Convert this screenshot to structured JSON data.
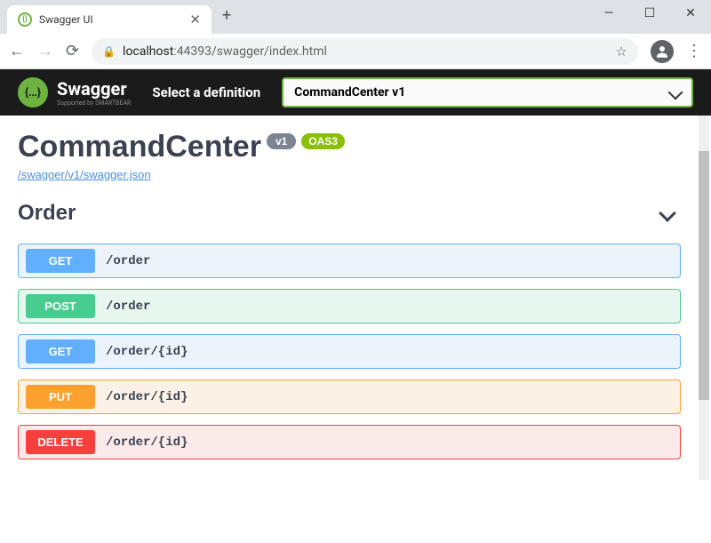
{
  "browser": {
    "tab_title": "Swagger UI",
    "url_host": "localhost",
    "url_port": ":44393",
    "url_path": "/swagger/index.html"
  },
  "header": {
    "logo_main": "Swagger",
    "logo_sub": "Supported by SMARTBEAR",
    "def_label": "Select a definition",
    "def_selected": "CommandCenter v1"
  },
  "api": {
    "title": "CommandCenter",
    "version": "v1",
    "oas": "OAS3",
    "spec_url": "/swagger/v1/swagger.json"
  },
  "tag": {
    "name": "Order",
    "ops": [
      {
        "method": "GET",
        "cls": "get",
        "path": "/order"
      },
      {
        "method": "POST",
        "cls": "post",
        "path": "/order"
      },
      {
        "method": "GET",
        "cls": "get",
        "path": "/order/{id}"
      },
      {
        "method": "PUT",
        "cls": "put",
        "path": "/order/{id}"
      },
      {
        "method": "DELETE",
        "cls": "delete",
        "path": "/order/{id}"
      }
    ]
  }
}
